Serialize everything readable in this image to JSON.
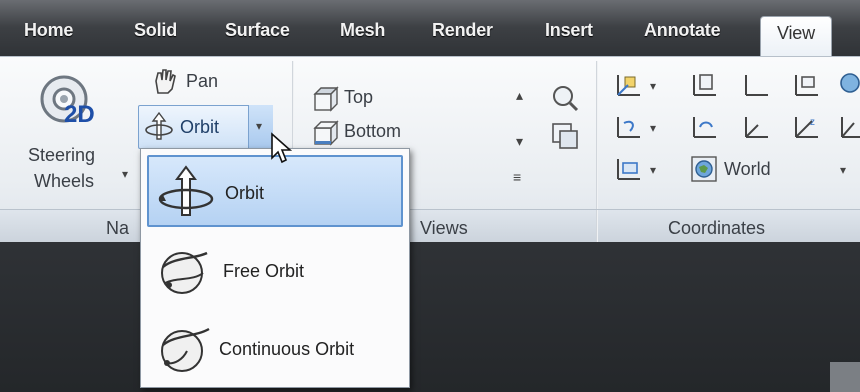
{
  "tabs": [
    {
      "label": "Home",
      "active": false
    },
    {
      "label": "Solid",
      "active": false
    },
    {
      "label": "Surface",
      "active": false
    },
    {
      "label": "Mesh",
      "active": false
    },
    {
      "label": "Render",
      "active": false
    },
    {
      "label": "Insert",
      "active": false
    },
    {
      "label": "Annotate",
      "active": false
    },
    {
      "label": "View",
      "active": true
    }
  ],
  "navigate": {
    "steering_label_1": "Steering",
    "steering_label_2": "Wheels",
    "steering_badge": "2D",
    "pan_label": "Pan",
    "orbit_label": "Orbit",
    "panel_title": "Na"
  },
  "views": {
    "items": [
      "Top",
      "Bottom"
    ],
    "panel_title": "Views"
  },
  "coordinates": {
    "world_label": "World",
    "panel_title": "Coordinates"
  },
  "orbit_menu": {
    "items": [
      {
        "label": "Orbit",
        "selected": true
      },
      {
        "label": "Free Orbit",
        "selected": false
      },
      {
        "label": "Continuous Orbit",
        "selected": false
      }
    ]
  },
  "colors": {
    "accent": "#5f93cf",
    "ribbon_bg": "#eef1f4",
    "tabbar_bg": "#3d4044",
    "viewport_bg": "#2a2c30"
  }
}
